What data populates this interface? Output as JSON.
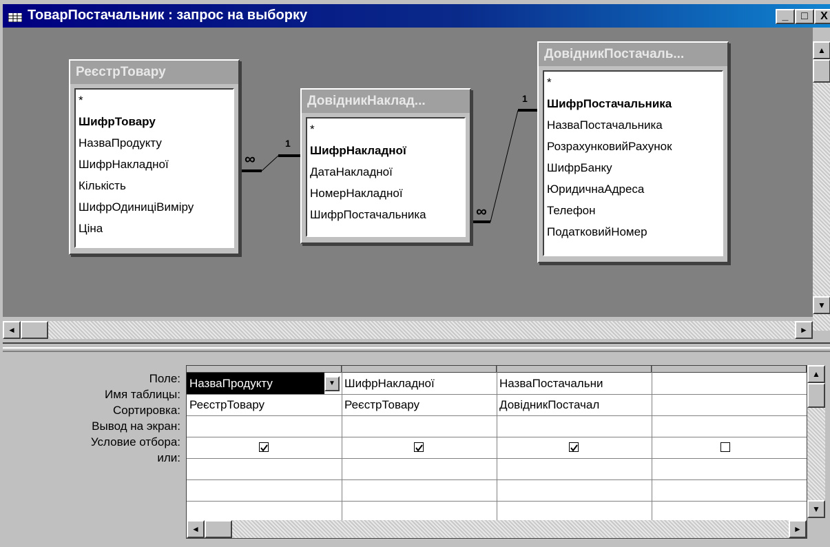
{
  "window": {
    "title": "ТоварПостачальник : запрос на выборку",
    "buttons": {
      "minimize": "_",
      "maximize": "□",
      "close": "X"
    }
  },
  "tables": [
    {
      "name": "РеєстрТовару",
      "fields": [
        "*",
        "ШифрТовару",
        "НазваПродукту",
        "ШифрНакладної",
        "Кількість",
        "ШифрОдиниціВиміру",
        "Ціна"
      ],
      "key": "ШифрТовару"
    },
    {
      "name": "ДовідникНаклад...",
      "fields": [
        "*",
        "ШифрНакладної",
        "ДатаНакладної",
        "НомерНакладної",
        "ШифрПостачальника"
      ],
      "key": "ШифрНакладної"
    },
    {
      "name": "ДовідникПостачаль...",
      "fields": [
        "*",
        "ШифрПостачальника",
        "НазваПостачальника",
        "РозрахунковийРахунок",
        "ШифрБанку",
        "ЮридичнаАдреса",
        "Телефон",
        "ПодатковийНомер"
      ],
      "key": "ШифрПостачальника"
    }
  ],
  "relations": [
    {
      "left_label": "∞",
      "right_label": "1"
    },
    {
      "left_label": "∞",
      "right_label": "1"
    }
  ],
  "grid": {
    "row_labels": [
      "Поле:",
      "Имя таблицы:",
      "Сортировка:",
      "Вывод на экран:",
      "Условие отбора:",
      "или:"
    ],
    "columns": [
      {
        "field": "НазваПродукту",
        "table": "РеєстрТовару",
        "sort": "",
        "show": true
      },
      {
        "field": "ШифрНакладної",
        "table": "РеєстрТовару",
        "sort": "",
        "show": true
      },
      {
        "field": "НазваПостачальни",
        "table": "ДовідникПостачал",
        "sort": "",
        "show": true
      },
      {
        "field": "",
        "table": "",
        "sort": "",
        "show": false
      }
    ]
  }
}
